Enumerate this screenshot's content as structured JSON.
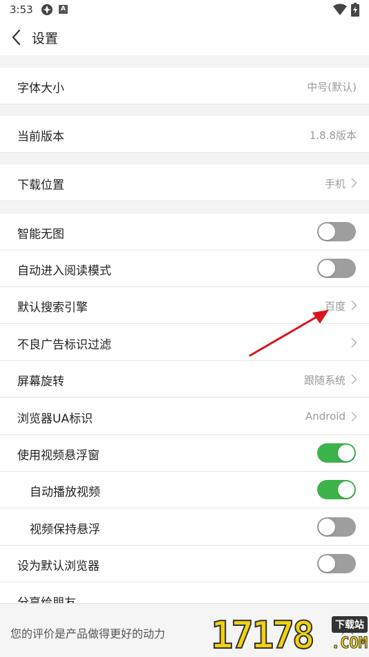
{
  "status_bar": {
    "time": "3:53",
    "app_icon2_letter": "A"
  },
  "header": {
    "title": "设置"
  },
  "rows": [
    {
      "label": "字体大小",
      "value": "中号(默认)"
    },
    {
      "label": "当前版本",
      "value": "1.8.8版本"
    },
    {
      "label": "下载位置",
      "value": "手机"
    },
    {
      "label": "智能无图",
      "toggle": "off"
    },
    {
      "label": "自动进入阅读模式",
      "toggle": "off"
    },
    {
      "label": "默认搜索引擎",
      "value": "百度"
    },
    {
      "label": "不良广告标识过滤"
    },
    {
      "label": "屏幕旋转",
      "value": "跟随系统"
    },
    {
      "label": "浏览器UA标识",
      "value": "Android"
    },
    {
      "label": "使用视频悬浮窗",
      "toggle": "on"
    },
    {
      "label": "自动播放视频",
      "toggle": "on"
    },
    {
      "label": "视频保持悬浮",
      "toggle": "off"
    },
    {
      "label": "设为默认浏览器",
      "toggle": "off"
    },
    {
      "label": "分享给朋友"
    }
  ],
  "bottom_bar": {
    "text": "您的评价是产品做得更好的动力"
  },
  "watermark": {
    "number": "17178",
    "badge": "下载站",
    "domain": ".COM"
  },
  "colors": {
    "toggle_on": "#3bb34a",
    "toggle_off": "#9e9e9e",
    "annotation_arrow": "#d9141b"
  }
}
